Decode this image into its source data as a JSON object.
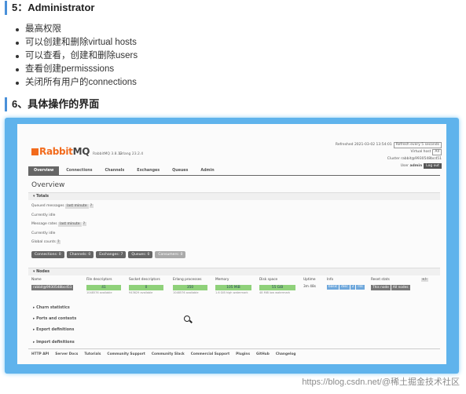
{
  "section5": {
    "title": "5：Administrator"
  },
  "bullets": [
    "最高权限",
    "可以创建和删除virtual hosts",
    "可以查看，创建和删除users",
    "查看创建permisssions",
    "关闭所有用户的connections"
  ],
  "section6": {
    "title": "6、具体操作的界面"
  },
  "rmq": {
    "logo_a": "Rabbit",
    "logo_b": "MQ",
    "version": "RabbitMQ 3.8.12",
    "erlang": "Erlang 23.2.4",
    "refreshed": "Refreshed 2021-03-02 13:54:01",
    "refresh_select": "Refresh every 5 seconds",
    "vhost_label": "Virtual host",
    "vhost_value": "All",
    "cluster": "Cluster rabbit@9930548bcd51",
    "user_label": "User",
    "user_value": "admin",
    "logout": "Log out",
    "tabs": [
      "Overview",
      "Connections",
      "Channels",
      "Exchanges",
      "Queues",
      "Admin"
    ],
    "page_title": "Overview",
    "totals": "Totals",
    "queued_label": "Queued messages",
    "queued_range": "last minute",
    "idle1": "Currently idle",
    "rates_label": "Message rates",
    "rates_range": "last minute",
    "idle2": "Currently idle",
    "global_counts": "Global counts",
    "counts": [
      "Connections: 0",
      "Channels: 0",
      "Exchanges: 7",
      "Queues: 0",
      "Consumers: 0"
    ],
    "nodes": "Nodes",
    "pm": "+/-",
    "cols": [
      "Name",
      "File descriptors",
      "Socket descriptors",
      "Erlang processes",
      "Memory",
      "Disk space",
      "Uptime",
      "Info",
      "Reset stats"
    ],
    "node": {
      "name": "rabbit@9930548bcd51",
      "fd": "41",
      "fd_sub": "1048576 available",
      "sd": "0",
      "sd_sub": "943629 available",
      "ep": "350",
      "ep_sub": "1048576 available",
      "mem": "105 MiB",
      "mem_sub": "1.6 GiB high watermark",
      "disk": "55 GiB",
      "disk_sub": "48 MiB low watermark",
      "uptime": "3m 48s",
      "info": [
        "basic",
        "disc",
        "2",
        "rss"
      ],
      "reset": [
        "This node",
        "All nodes"
      ]
    },
    "sections": [
      "Churn statistics",
      "Ports and contexts",
      "Export definitions",
      "Import definitions"
    ],
    "footer": [
      "HTTP API",
      "Server Docs",
      "Tutorials",
      "Community Support",
      "Community Slack",
      "Commercial Support",
      "Plugins",
      "GitHub",
      "Changelog"
    ]
  },
  "watermark": "https://blog.csdn.net/@稀土掘金技术社区"
}
